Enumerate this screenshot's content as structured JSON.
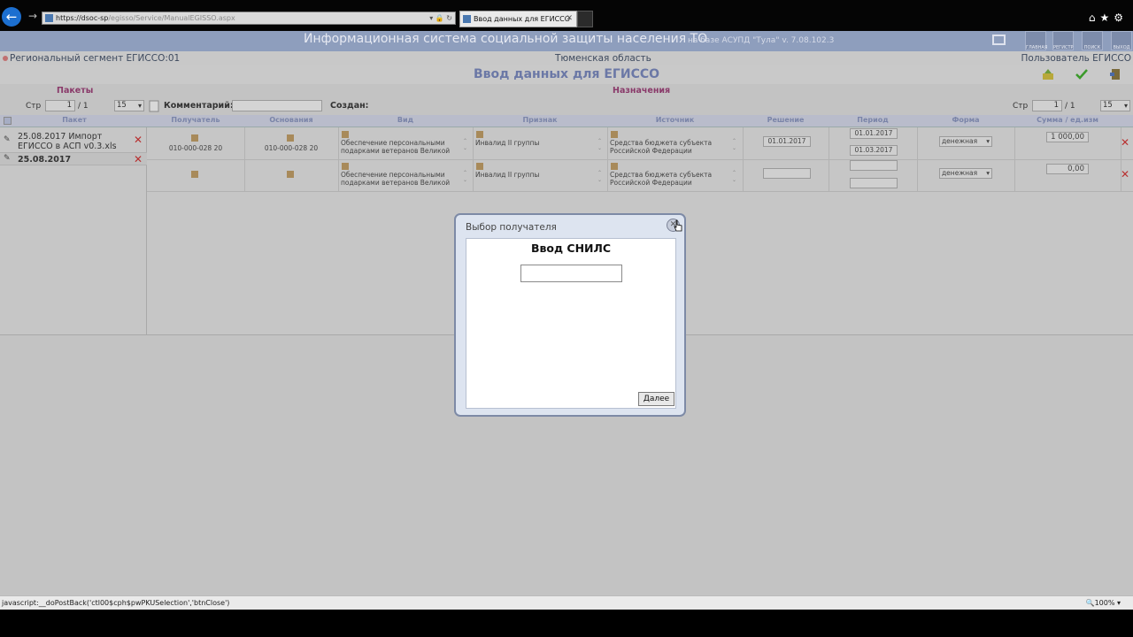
{
  "browser": {
    "url_host": "https://dsoc-sp",
    "url_path": "/egisso/Service/ManualEGISSO.aspx",
    "tab_title": "Ввод данных для ЕГИССО",
    "tab_close": "✕",
    "url_icons": "▾ 🔒 ↻",
    "right_icons": "⌂★⚙"
  },
  "app": {
    "title": "Информационная система социальной защиты населения ТО",
    "base": "на базе АСУПД \"Тула\"   v. 7.08.102.3",
    "header_icons": [
      {
        "label": "ГЛАВНАЯ",
        "icon": "home-icon"
      },
      {
        "label": "РЕГИСТР",
        "icon": "people-icon"
      },
      {
        "label": "ПОИСК",
        "icon": "search-icon"
      },
      {
        "label": "ВЫХОД",
        "icon": "exit-icon"
      }
    ]
  },
  "info": {
    "segment": "Региональный сегмент ЕГИССО:01",
    "region": "Тюменская область",
    "user": "Пользователь ЕГИССО"
  },
  "page_title": "Ввод данных для ЕГИССО",
  "sections": {
    "packets": "Пакеты",
    "assignments": "Назначения"
  },
  "left_pager": {
    "label": "Стр",
    "page": "1",
    "total": "/ 1",
    "size": "15"
  },
  "right_pager": {
    "label": "Стр",
    "page": "1",
    "total": "/ 1",
    "size": "15"
  },
  "toolbar": {
    "comment_label": "Комментарий:",
    "created_label": "Создан:"
  },
  "packets": {
    "header": "Пакет",
    "rows": [
      {
        "text": "25.08.2017 Импорт ЕГИССО в АСП v0.3.xls",
        "bold": false
      },
      {
        "text": "25.08.2017",
        "bold": true
      }
    ]
  },
  "grid": {
    "headers": [
      "Получатель",
      "Основания",
      "Вид",
      "Признак",
      "Источник",
      "Решение",
      "Период",
      "Форма",
      "Сумма / ед.изм"
    ],
    "rows": [
      {
        "recipient": "010-000-028 20",
        "basis": "010-000-028 20",
        "kind": "Обеспечение персональными подарками ветеранов Великой",
        "sign": "Инвалид II группы",
        "source": "Средства бюджета субъекта Российской Федерации",
        "decision": "01.01.2017",
        "period_from": "01.01.2017",
        "period_to": "01.03.2017",
        "form": "денежная",
        "amount": "1 000,00"
      },
      {
        "recipient": "",
        "basis": "",
        "kind": "Обеспечение персональными подарками ветеранов Великой",
        "sign": "Инвалид II группы",
        "source": "Средства бюджета субъекта Российской Федерации",
        "decision": "",
        "period_from": "",
        "period_to": "",
        "form": "денежная",
        "amount": "0,00"
      }
    ]
  },
  "modal": {
    "title": "Выбор получателя",
    "heading": "Ввод СНИЛС",
    "snils_value": "",
    "next_label": "Далее",
    "close": "✕"
  },
  "status": {
    "text": "javascript:__doPostBack('ctl00$cph$pwPKUSelection','btnClose')",
    "zoom": "🔍100%  ▾"
  },
  "colors": {
    "header_bg": "#8e9ebd",
    "title_text": "#6b78a6",
    "section_text": "#8a3a6a",
    "delete_red": "#b83030"
  }
}
